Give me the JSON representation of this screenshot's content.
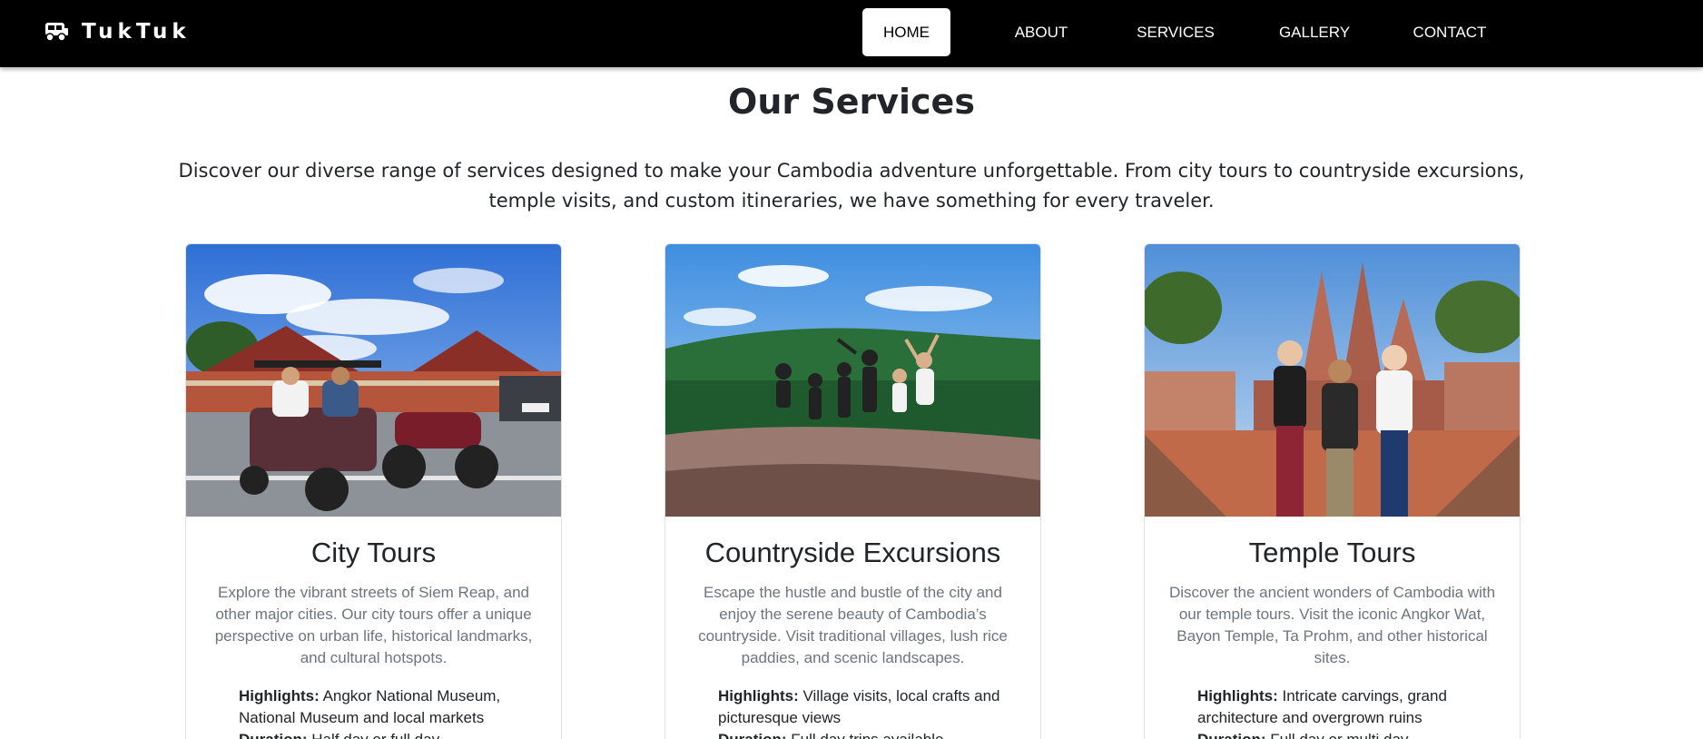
{
  "brand": {
    "name": "TukTuk",
    "icon": "tuktuk-icon"
  },
  "nav": {
    "home": "HOME",
    "about": "ABOUT",
    "services": "SERVICES",
    "gallery": "GALLERY",
    "contact": "CONTACT"
  },
  "page": {
    "title": "Our Services",
    "intro": "Discover our diverse range of services designed to make your Cambodia adventure unforgettable. From city tours to countryside excursions, temple visits, and custom itineraries, we have something for every traveler."
  },
  "services": [
    {
      "title": "City Tours",
      "description": "Explore the vibrant streets of Siem Reap, and other major cities. Our city tours offer a unique perspective on urban life, historical landmarks, and cultural hotspots.",
      "highlights_label": "Highlights:",
      "highlights": "Angkor National Museum, National Museum and local markets",
      "duration_label": "Duration:",
      "duration": "Half day or full day"
    },
    {
      "title": "Countryside Excursions",
      "description": "Escape the hustle and bustle of the city and enjoy the serene beauty of Cambodia’s countryside. Visit traditional villages, lush rice paddies, and scenic landscapes.",
      "highlights_label": "Highlights:",
      "highlights": "Village visits, local crafts and picturesque views",
      "duration_label": "Duration:",
      "duration": "Full day trips available"
    },
    {
      "title": "Temple Tours",
      "description": "Discover the ancient wonders of Cambodia with our temple tours. Visit the iconic Angkor Wat, Bayon Temple, Ta Prohm, and other historical sites.",
      "highlights_label": "Highlights:",
      "highlights": "Intricate carvings, grand architecture and overgrown ruins",
      "duration_label": "Duration:",
      "duration": "Full day or multi day"
    }
  ],
  "colors": {
    "navbar": "#000000",
    "active_tab_bg": "#ffffff",
    "text": "#212529",
    "muted": "#6c757d"
  }
}
